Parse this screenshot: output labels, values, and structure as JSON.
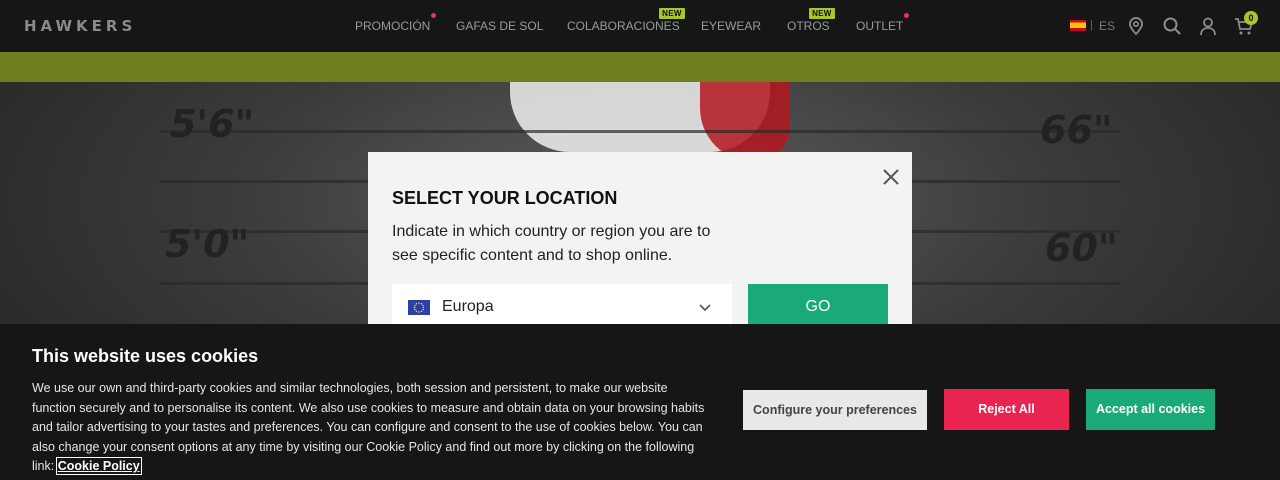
{
  "header": {
    "logo": "HAWKERS",
    "nav": [
      {
        "label": "PROMOCIÓN",
        "badge": "dot"
      },
      {
        "label": "GAFAS DE SOL",
        "badge": ""
      },
      {
        "label": "COLABORACIONES",
        "badge": "NEW"
      },
      {
        "label": "EYEWEAR",
        "badge": ""
      },
      {
        "label": "OTROS",
        "badge": "NEW"
      },
      {
        "label": "OUTLET",
        "badge": "dot"
      }
    ],
    "language": "ES",
    "language_separator": "|",
    "cart_count": "0",
    "icons": [
      "flag-es-icon",
      "location-pin-icon",
      "search-icon",
      "user-icon",
      "cart-icon"
    ]
  },
  "hero": {
    "marks": [
      "5'6\"",
      "66\"",
      "5'0\"",
      "60\""
    ]
  },
  "location_modal": {
    "title": "SELECT YOUR LOCATION",
    "text": "Indicate in which country or region you are to see specific content and to shop online.",
    "selected_region": "Europa",
    "go_label": "GO"
  },
  "cookie_banner": {
    "title": "This website uses cookies",
    "text": "We use our own and third-party cookies and similar technologies, both session and persistent, to make our website function securely and to personalise its content. We also use cookies to measure and obtain data on your browsing habits and tailor advertising to your tastes and preferences. You can configure and consent to the use of cookies below. You can also change your consent options at any time by visiting our Cookie Policy and find out more by clicking on the following link:",
    "link_label": "Cookie Policy",
    "configure_label": "Configure your preferences",
    "reject_label": "Reject All",
    "accept_label": "Accept all cookies"
  },
  "colors": {
    "accent_green": "#1aaa78",
    "reject_red": "#ea2450",
    "lime_badge": "#a8c52c",
    "promo_strip": "#6e7f1d"
  }
}
